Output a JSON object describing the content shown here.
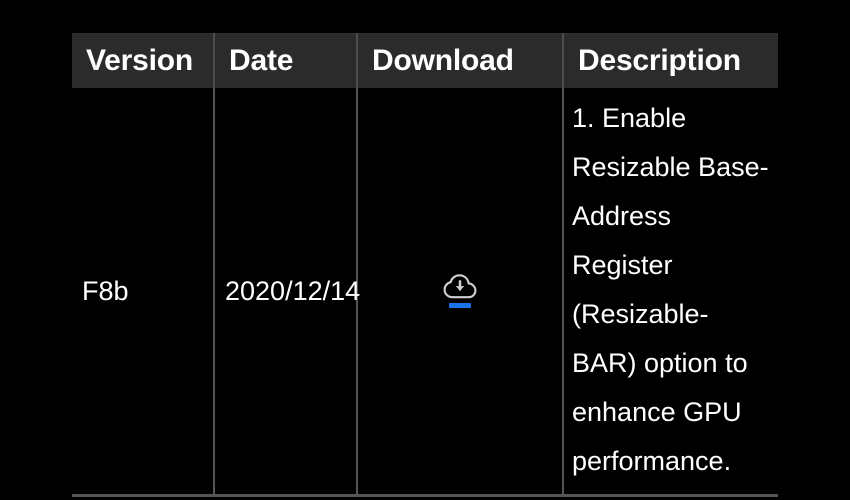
{
  "table": {
    "columns": [
      {
        "key": "version",
        "label": "Version"
      },
      {
        "key": "date",
        "label": "Date"
      },
      {
        "key": "download",
        "label": "Download"
      },
      {
        "key": "description",
        "label": "Description"
      }
    ],
    "rows": [
      {
        "version": "F8b",
        "date": "2020/12/14",
        "download": {
          "icon": "cloud-download-icon",
          "underline_color": "#1a73e8"
        },
        "description": "1. Enable Resizable Base-Address Register (Resizable-BAR) option to enhance GPU performance."
      }
    ]
  },
  "colors": {
    "page_background": "#000000",
    "header_background": "#2b2b2b",
    "header_text": "#ffffff",
    "body_text": "#ffffff",
    "grid_line": "#555555",
    "accent": "#1a73e8",
    "icon": "#d0d0d0"
  }
}
